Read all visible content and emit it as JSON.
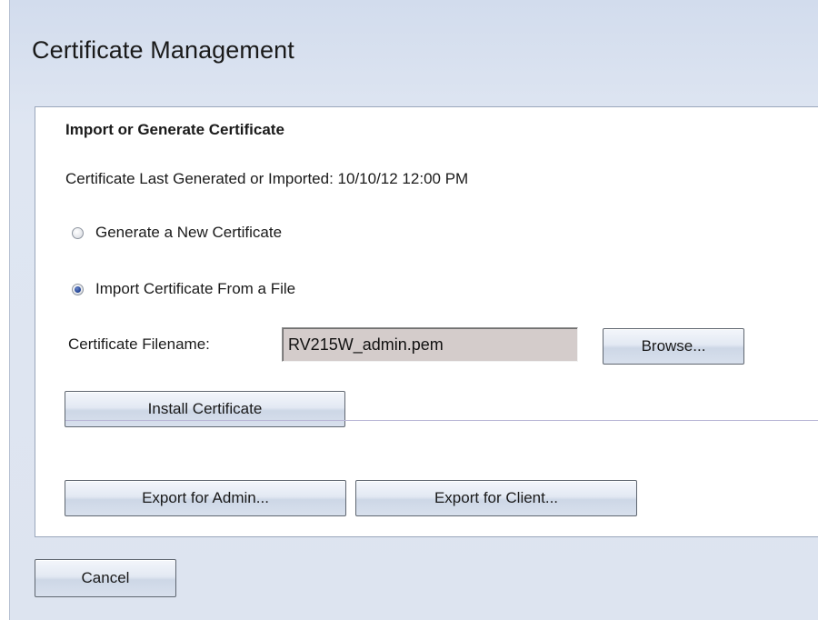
{
  "page": {
    "title": "Certificate Management"
  },
  "section": {
    "title": "Import or Generate Certificate",
    "last_generated": "Certificate Last Generated or Imported: 10/10/12 12:00 PM"
  },
  "options": [
    {
      "label": "Generate a New Certificate",
      "checked": false
    },
    {
      "label": "Import Certificate From a File",
      "checked": true
    }
  ],
  "file": {
    "label": "Certificate Filename:",
    "value": "RV215W_admin.pem",
    "browse_label": "Browse..."
  },
  "buttons": {
    "install": "Install Certificate",
    "export_admin": "Export for Admin...",
    "export_client": "Export for Client...",
    "cancel": "Cancel"
  },
  "colors": {
    "background": "#dfe6f2",
    "panel": "#ffffff",
    "input_bg": "#d4cccb",
    "radio_selected": "#1d3f91"
  }
}
